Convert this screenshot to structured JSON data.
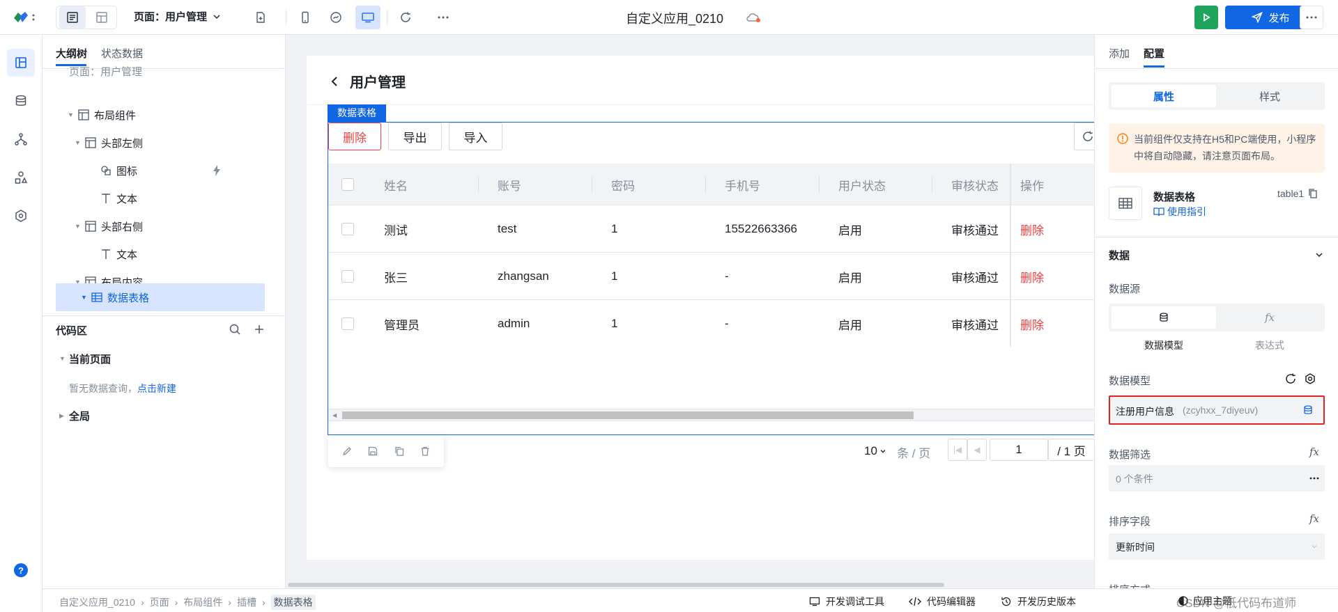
{
  "topbar": {
    "page_label": "页面：用户管理",
    "app_title": "自定义应用_0210",
    "publish_label": "发布"
  },
  "outline": {
    "tabs": [
      "大纲树",
      "状态数据"
    ],
    "tree": [
      {
        "label": "页面：用户管理",
        "indent": 0,
        "icon": "layout-icon"
      },
      {
        "label": "布局组件",
        "indent": 1,
        "icon": "layout-icon"
      },
      {
        "label": "头部左侧",
        "indent": 2,
        "icon": "layout-icon"
      },
      {
        "label": "图标",
        "indent": 3,
        "icon": "shapes-icon"
      },
      {
        "label": "文本",
        "indent": 3,
        "icon": "text-icon"
      },
      {
        "label": "头部右侧",
        "indent": 2,
        "icon": "layout-icon"
      },
      {
        "label": "文本",
        "indent": 3,
        "icon": "text-icon"
      },
      {
        "label": "布局内容",
        "indent": 2,
        "icon": "layout-icon"
      },
      {
        "label": "数据表格",
        "indent": 3,
        "icon": "table-icon",
        "selected": true
      }
    ],
    "code_title": "代码区",
    "current_page": "当前页面",
    "empty_text": "暂无数据查询，",
    "create_link": "点击新建",
    "global": "全局"
  },
  "canvas": {
    "page_title": "用户管理",
    "component_tag": "数据表格",
    "buttons": {
      "delete": "删除",
      "export": "导出",
      "import": "导入"
    },
    "columns": [
      "姓名",
      "账号",
      "密码",
      "手机号",
      "用户状态",
      "审核状态",
      "操作"
    ],
    "rows": [
      {
        "name": "测试",
        "account": "test",
        "password": "1",
        "phone": "15522663366",
        "status": "启用",
        "audit": "审核通过",
        "action": "删除"
      },
      {
        "name": "张三",
        "account": "zhangsan",
        "password": "1",
        "phone": "-",
        "status": "启用",
        "audit": "审核通过",
        "action": "删除"
      },
      {
        "name": "管理员",
        "account": "admin",
        "password": "1",
        "phone": "-",
        "status": "启用",
        "audit": "审核通过",
        "action": "删除"
      }
    ],
    "pagination": {
      "page_size": "10",
      "per_page_label": "条 / 页",
      "current_page": "1",
      "total_label": "/ 1 页"
    }
  },
  "right_panel": {
    "tabs": [
      "添加",
      "配置"
    ],
    "seg": [
      "属性",
      "样式"
    ],
    "warning": "当前组件仅支持在H5和PC端使用，小程序中将自动隐藏，请注意页面布局。",
    "component_name": "数据表格",
    "component_id": "table1",
    "guide_link": "使用指引",
    "section_data": "数据",
    "datasource_label": "数据源",
    "ds_options": [
      "数据模型",
      "表达式"
    ],
    "model_label": "数据模型",
    "model_value": "注册用户信息",
    "model_id": "(zcyhxx_7diyeuv)",
    "filter_label": "数据筛选",
    "filter_value": "0 个条件",
    "sort_label": "排序字段",
    "sort_value": "更新时间",
    "order_label": "排序方式"
  },
  "statusbar": {
    "breadcrumb": [
      "自定义应用_0210",
      "页面",
      "布局组件",
      "插槽",
      "数据表格"
    ],
    "tools": [
      "开发调试工具",
      "代码编辑器",
      "开发历史版本",
      "应用主题"
    ],
    "watermark": "CSDN @低代码布道师"
  }
}
